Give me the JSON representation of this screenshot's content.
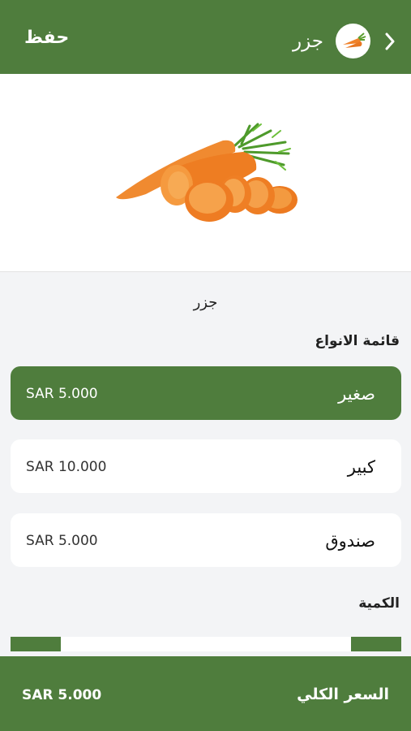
{
  "header": {
    "save_label": "حفظ",
    "title": "جزر",
    "back_icon": "chevron-right-icon",
    "avatar_icon": "carrot-icon"
  },
  "product": {
    "name": "جزر",
    "image_icon": "carrot-image"
  },
  "types": {
    "title": "قائمة الانواع",
    "options": [
      {
        "name": "صغير",
        "price": "SAR 5.000",
        "selected": true
      },
      {
        "name": "كبير",
        "price": "SAR 10.000",
        "selected": false
      },
      {
        "name": "صندوق",
        "price": "SAR 5.000",
        "selected": false
      }
    ]
  },
  "quantity": {
    "title": "الكمية"
  },
  "footer": {
    "total_label": "السعر الكلي",
    "total_price": "SAR 5.000"
  },
  "colors": {
    "accent": "#4f7d3d",
    "carrot": "#f0822a"
  }
}
